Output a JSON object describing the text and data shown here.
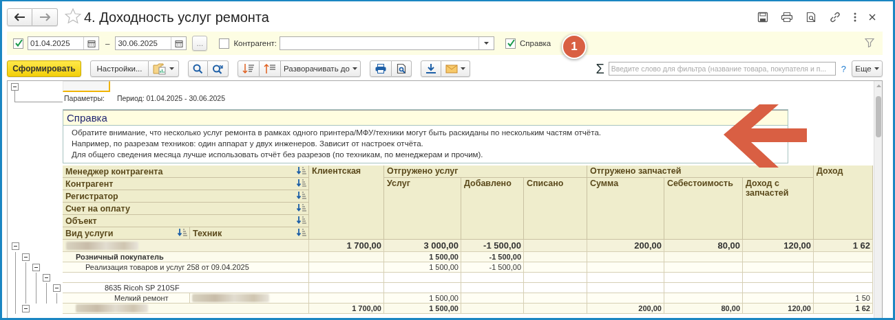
{
  "window": {
    "title": "4. Доходность услуг ремонта"
  },
  "filter_bar": {
    "period_checked": true,
    "date_from": "01.04.2025",
    "separator": "–",
    "date_to": "30.06.2025",
    "more_button": "...",
    "counterparty_checked": false,
    "counterparty_label": "Контрагент:",
    "help_checked": true,
    "help_label": "Справка",
    "badge": "1"
  },
  "toolbar": {
    "generate_button": "Сформировать",
    "settings_button": "Настройки...",
    "expand_button": "Разворачивать до",
    "sum_symbol": "Σ",
    "search_placeholder": "Введите слово для фильтра (название товара, покупателя и п...",
    "help_link": "?",
    "more_button": "Еще"
  },
  "report": {
    "header_expanded": true,
    "parameters_label": "Параметры:",
    "period": "Период: 01.04.2025 - 30.06.2025",
    "help": {
      "title": "Справка",
      "lines": [
        "Обратите внимание, что несколько услуг ремонта в рамках одного принтера/МФУ/техники могут быть раскиданы по нескольким частям отчёта.",
        "Например, по разрезам техников: один аппарат у двух инженеров. Зависит от настроек отчёта.",
        "Для общего сведения месяца лучше использовать отчёт без разрезов (по техникам, по менеджерам и прочим)."
      ]
    },
    "grouping_rows": [
      [
        "Менеджер контрагента"
      ],
      [
        "Контрагент"
      ],
      [
        "Регистратор"
      ],
      [
        "Счет на оплату"
      ],
      [
        "Объект"
      ],
      [
        "Вид услуги",
        "Техник"
      ]
    ],
    "columns": [
      {
        "label": "Клиентская"
      },
      {
        "group": "Отгружено услуг",
        "children": [
          "Услуг",
          "Добавлено",
          "Списано"
        ]
      },
      {
        "group": "Отгружено запчастей",
        "children": [
          "Сумма",
          "Себестоимость",
          "Доход с запчастей"
        ]
      },
      {
        "label": "Доход"
      }
    ],
    "rows": [
      {
        "kind": "group",
        "blurred": true,
        "expanded": true,
        "values": {
          "client": "1 700,00",
          "services": "3 000,00",
          "added": "-1 500,00",
          "parts_sum": "200,00",
          "parts_cost": "80,00",
          "parts_income": "120,00",
          "income": "1 62"
        },
        "children": [
          {
            "kind": "subgroup",
            "label": "Розничный покупатель",
            "expanded": true,
            "values": {
              "services": "1 500,00",
              "added": "-1 500,00"
            },
            "children": [
              {
                "kind": "document",
                "label": "Реализация товаров и услуг 258 от 09.04.2025",
                "expanded": true,
                "values": {
                  "services": "1 500,00",
                  "added": "-1 500,00"
                },
                "children": [
                  {
                    "kind": "blank",
                    "expanded": true,
                    "children": [
                      {
                        "kind": "object",
                        "label": "8635 Ricoh SP 210SF",
                        "expanded": true,
                        "children": [
                          {
                            "kind": "service",
                            "label": "Мелкий ремонт",
                            "technician_blurred": true,
                            "values": {
                              "services": "1 500,00",
                              "income": "1 50"
                            }
                          }
                        ]
                      }
                    ]
                  }
                ]
              }
            ]
          },
          {
            "kind": "subgroup",
            "blurred": true,
            "expanded": true,
            "values": {
              "client": "1 700,00",
              "services": "1 500,00",
              "parts_sum": "200,00",
              "parts_cost": "80,00",
              "parts_income": "120,00",
              "income": "1 62"
            }
          }
        ]
      }
    ]
  }
}
